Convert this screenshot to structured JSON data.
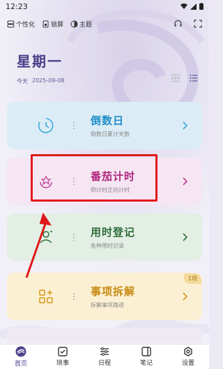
{
  "status": {
    "time": "12:23"
  },
  "topbar": {
    "personalize": "个性化",
    "lock": "锁屏",
    "theme": "主题"
  },
  "header": {
    "weekday": "星期一",
    "today_label": "今天",
    "date": "2025-09-08"
  },
  "cards": [
    {
      "title": "倒数日",
      "subtitle": "倒数日累计天数",
      "icon": "clock-icon"
    },
    {
      "title": "番茄计时",
      "subtitle": "倒计时正向计时",
      "icon": "tomato-icon"
    },
    {
      "title": "用时登记",
      "subtitle": "各种用时记录",
      "icon": "timer-register-icon"
    },
    {
      "title": "事项拆解",
      "subtitle": "拆解事项路进",
      "icon": "task-split-icon",
      "badge": "1项"
    }
  ],
  "nav": [
    {
      "label": "首页",
      "icon": "home-icon",
      "active": true
    },
    {
      "label": "琐事",
      "icon": "check-box-icon"
    },
    {
      "label": "日程",
      "icon": "schedule-list-icon"
    },
    {
      "label": "笔记",
      "icon": "notebook-icon"
    },
    {
      "label": "设置",
      "icon": "settings-gear-icon"
    }
  ],
  "colors": {
    "accent": "#4b3f8a",
    "card_blue": "#dcecf6",
    "card_pink": "#f6e6f3",
    "card_green": "#e3efe4",
    "card_yellow": "#fbf0d3",
    "highlight_red": "#e0181b"
  }
}
